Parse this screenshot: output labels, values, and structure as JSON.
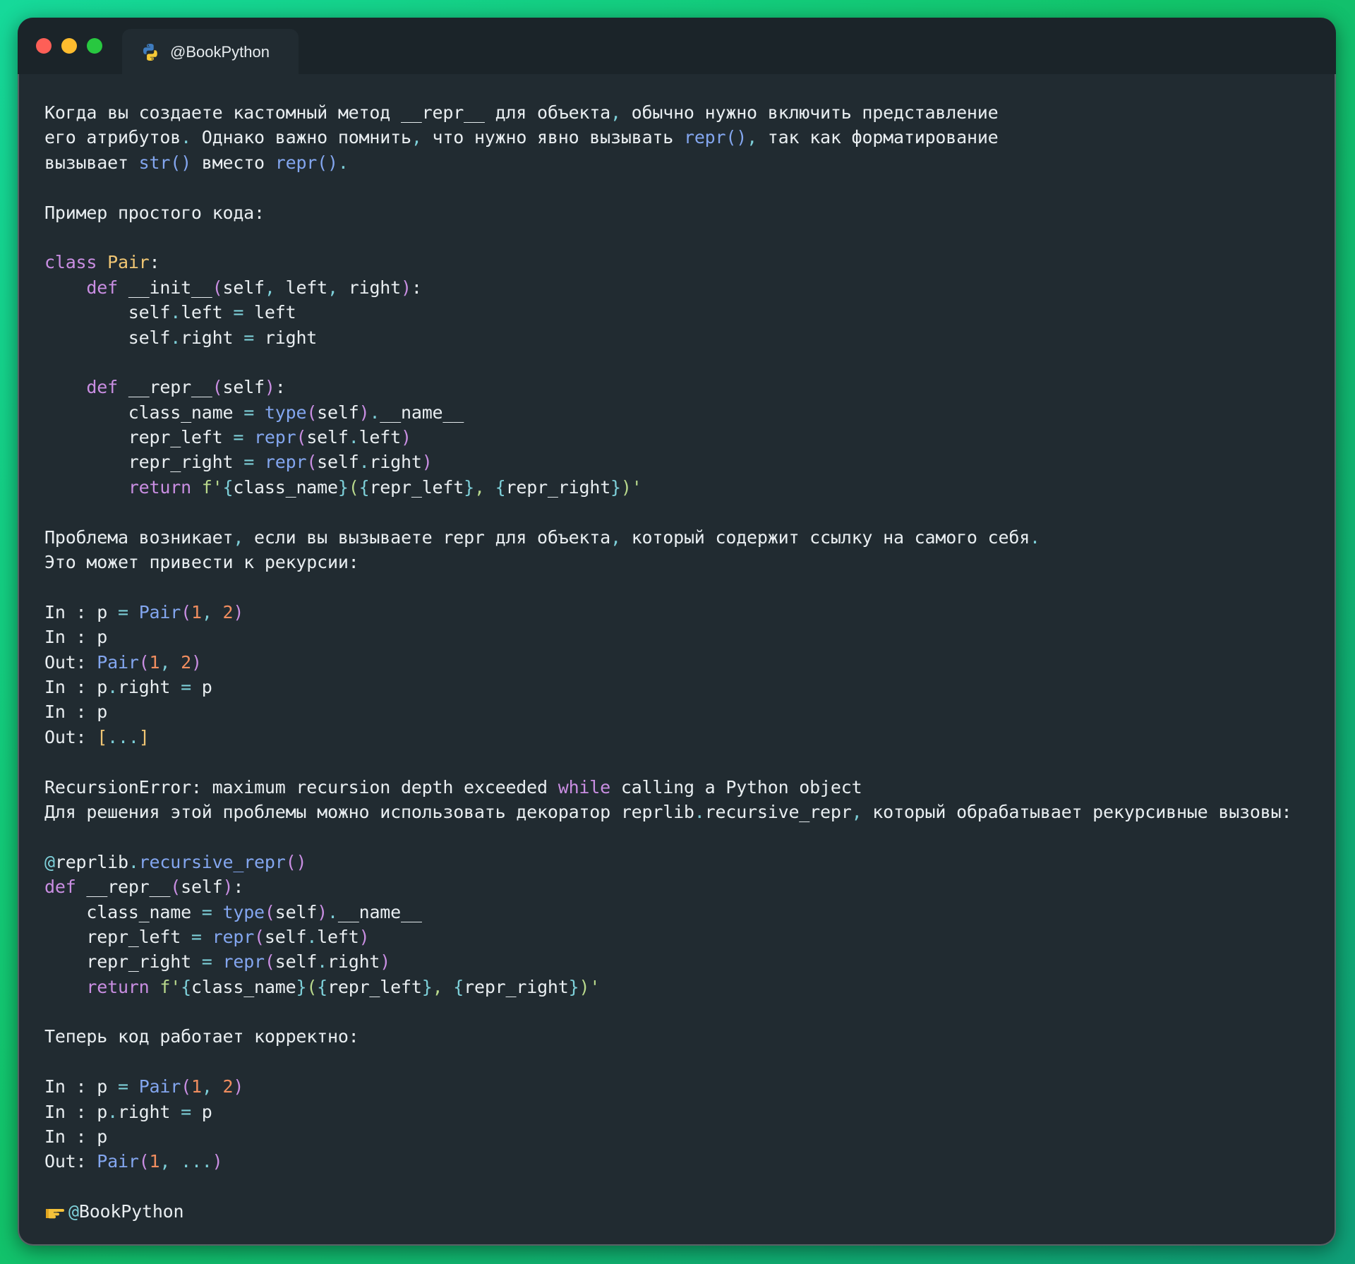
{
  "window": {
    "tab_title": "@BookPython",
    "controls": [
      "close",
      "minimize",
      "maximize"
    ]
  },
  "colors": {
    "background_gradient": [
      "#16d99a",
      "#12c46a",
      "#0f9f78"
    ],
    "window_bg": "#212b31",
    "keyword": "#c98ee2",
    "class_name": "#f0c674",
    "builtin_function": "#83a6ef",
    "number": "#f08d5f",
    "operator": "#7dcfd8",
    "string": "#b9d98c"
  },
  "icons": {
    "tab": "python-logo-icon",
    "footer": "pointing-hand-icon"
  },
  "text": {
    "intro_1": "Когда вы создаете кастомный метод __repr__ для объекта",
    "intro_1_rest": " обычно нужно включить представление",
    "intro_2": "его атрибутов",
    "intro_2_mid": " Однако важно помнить",
    "intro_2_mid2": " что нужно явно вызывать ",
    "intro_2_repr": "repr()",
    "intro_2_end": " так как форматирование",
    "intro_3": "вызывает ",
    "intro_3_str": "str()",
    "intro_3_mid": " вместо ",
    "intro_3_repr": "repr()",
    "example_heading": "Пример простого кода:",
    "problem_1": "Проблема возникает",
    "problem_1_mid": " если вы вызываете repr для объекта",
    "problem_1_end": " который содержит ссылку на самого себя",
    "problem_2": "Это может привести к рекурсии:",
    "error_1": "RecursionError: maximum recursion depth exceeded ",
    "error_while": "while",
    "error_1_end": " calling a Python object",
    "solution_1": "Для решения этой проблемы можно использовать декоратор reprlib",
    "solution_1_attr": "recursive_repr",
    "solution_1_end": " который обрабатывает рекурсивные вызовы:",
    "works_heading": "Теперь код работает корректно:",
    "footer": "@BookPython"
  }
}
